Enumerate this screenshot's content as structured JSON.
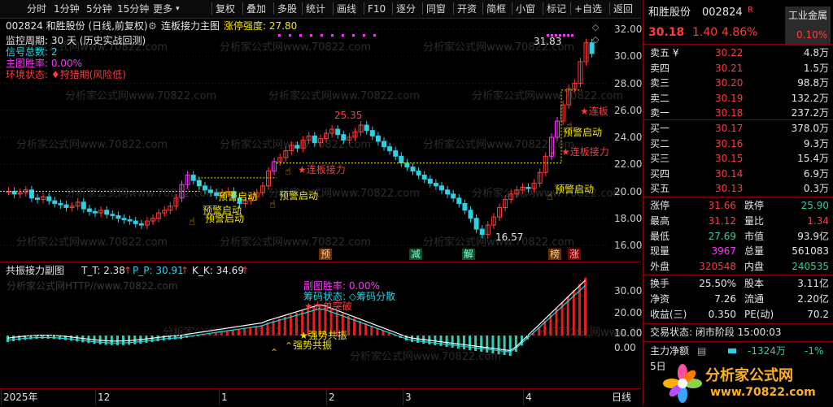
{
  "toolbar": {
    "items": [
      "分时",
      "1分钟",
      "5分钟",
      "15分钟",
      "更多",
      "复权",
      "叠加",
      "多股",
      "统计",
      "画线",
      "F10",
      "逐分",
      "同窗",
      "开资",
      "简框",
      "小窗",
      "标记",
      "+自选",
      "返回"
    ],
    "more_arrow": "▾"
  },
  "main": {
    "title": "002824 和胜股份 (日线,前复权)",
    "indicator_name": "连板接力主图",
    "strength_label": "涨停强度: 27.80",
    "lines": [
      {
        "text": "监控周期: 30 天 (历史实战回测)",
        "color": "#e6e6e6"
      },
      {
        "text": "信号总数: 2",
        "color": "#27d3e6"
      },
      {
        "text": "主图胜率: 0.00%",
        "color": "#ff33ff"
      },
      {
        "text": "环境状态: ♦狩猎期(风险低)",
        "color": "#ff3b3b"
      }
    ],
    "high_label": "31.83",
    "mid_label": "25.35",
    "low_label": "16.57",
    "y_ticks": [
      "32.00",
      "30.00",
      "28.00",
      "26.00",
      "24.00",
      "22.00",
      "20.00",
      "18.00",
      "16.00"
    ],
    "y_values": [
      32,
      30,
      28,
      26,
      24,
      22,
      20,
      18,
      16
    ],
    "annotations": [
      {
        "text": "★连板接力",
        "color": "#ff3b3b"
      },
      {
        "text": "预警启动",
        "color": "#f2e600"
      },
      {
        "text": "预警启动",
        "color": "#f2e600"
      },
      {
        "text": "预警启动",
        "color": "#f2e600"
      },
      {
        "text": "预警启动",
        "color": "#f2e600"
      },
      {
        "text": "★连板接力",
        "color": "#ff3b3b"
      },
      {
        "text": "预警启动",
        "color": "#f2e600"
      },
      {
        "text": "★连板",
        "color": "#ff3b3b"
      },
      {
        "text": "预警启动",
        "color": "#f2e600"
      }
    ],
    "signal_tags": [
      "预",
      "减",
      "解",
      "榜",
      "涨"
    ],
    "watermark": "分析家公式网www.70822.com"
  },
  "sub": {
    "title": "共振接力副图",
    "tt": "T_T: 2.38",
    "pp": "P_P: 30.91",
    "kk": "K_K: 34.69",
    "watermark": "分析家公式网HTTP//www.70822.com",
    "texts": [
      {
        "text": "副图胜率: 0.00%",
        "color": "#ff33ff"
      },
      {
        "text": "筹码状态: ◇筹码分散",
        "color": "#27d3e6"
      },
      {
        "text": "★大单突破",
        "color": "#ff3b3b"
      },
      {
        "text": "★强势共振",
        "color": "#f2e600"
      },
      {
        "text": "强势共振",
        "color": "#f2e600"
      }
    ],
    "y_ticks": [
      "30.00",
      "20.00",
      "10.00",
      "0.00"
    ]
  },
  "axis": {
    "labels": [
      "2025年",
      "12",
      "1",
      "2",
      "3",
      "4"
    ],
    "period": "日线"
  },
  "panel": {
    "name": "和胜股份",
    "code": "002824",
    "badge": "R",
    "sector": "工业金属",
    "sector_pct": "0.10%",
    "price": "30.18",
    "change": "1.40",
    "pct": "4.86%",
    "asks": [
      {
        "label": "卖五 ¥",
        "price": "30.22",
        "vol": "4.8万"
      },
      {
        "label": "卖四",
        "price": "30.21",
        "vol": "1.5万"
      },
      {
        "label": "卖三",
        "price": "30.20",
        "vol": "98.8万"
      },
      {
        "label": "卖二",
        "price": "30.19",
        "vol": "132.2万"
      },
      {
        "label": "卖一",
        "price": "30.18",
        "vol": "237.2万"
      }
    ],
    "bids": [
      {
        "label": "买一",
        "price": "30.17",
        "vol": "378.0万"
      },
      {
        "label": "买二",
        "price": "30.16",
        "vol": "9.3万"
      },
      {
        "label": "买三",
        "price": "30.15",
        "vol": "15.4万"
      },
      {
        "label": "买四",
        "price": "30.14",
        "vol": "6.9万"
      },
      {
        "label": "买五",
        "price": "30.13",
        "vol": "0.3万"
      }
    ],
    "stats": [
      {
        "l1": "涨停",
        "v1": "31.66",
        "c1": "red",
        "l2": "跌停",
        "v2": "25.90",
        "c2": "green"
      },
      {
        "l1": "最高",
        "v1": "31.12",
        "c1": "red",
        "l2": "量比",
        "v2": "1.34",
        "c2": "red"
      },
      {
        "l1": "最低",
        "v1": "27.69",
        "c1": "green",
        "l2": "市值",
        "v2": "93.9亿",
        "c2": "white"
      },
      {
        "l1": "现量",
        "v1": "3967",
        "c1": "mag",
        "l2": "总量",
        "v2": "561083",
        "c2": "white"
      },
      {
        "l1": "外盘",
        "v1": "320548",
        "c1": "red",
        "l2": "内盘",
        "v2": "240535",
        "c2": "green"
      }
    ],
    "stats2": [
      {
        "l1": "换手",
        "v1": "25.50%",
        "l2": "股本",
        "v2": "3.11亿"
      },
      {
        "l1": "净资",
        "v1": "7.26",
        "l2": "流通",
        "v2": "2.20亿"
      },
      {
        "l1": "收益(三)",
        "v1": "0.350",
        "l2": "PE(动)",
        "v2": "70.2"
      }
    ],
    "trade_state": "交易状态: 闭市阶段 15:00:03",
    "netflow_label": "主力净额",
    "netflow_value": "-1324万",
    "netflow_pct": "-1%",
    "netflow_5": "5日",
    "logo_text": "分析家公式网",
    "logo_url": "www.70822.com"
  }
}
